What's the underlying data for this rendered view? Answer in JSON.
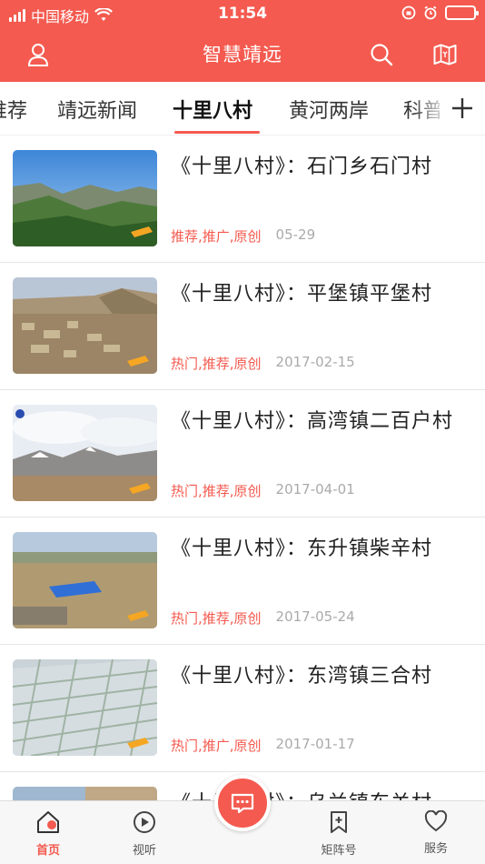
{
  "status_bar": {
    "carrier": "中国移动",
    "time": "11:54"
  },
  "header": {
    "title": "智慧靖远",
    "icons": [
      "user-icon",
      "search-icon",
      "map-icon"
    ]
  },
  "tabs": {
    "items": [
      {
        "label": "推荐"
      },
      {
        "label": "靖远新闻"
      },
      {
        "label": "十里八村"
      },
      {
        "label": "黄河两岸"
      },
      {
        "label": "科普"
      }
    ],
    "active": "十里八村",
    "add_icon": "plus-icon"
  },
  "news": [
    {
      "title": "《十里八村》：石门乡石门村",
      "tags": "推荐,推广,原创",
      "date": "05-29"
    },
    {
      "title": "《十里八村》：平堡镇平堡村",
      "tags": "热门,推荐,原创",
      "date": "2017-02-15"
    },
    {
      "title": "《十里八村》：高湾镇二百户村",
      "tags": "热门,推荐,原创",
      "date": "2017-04-01"
    },
    {
      "title": "《十里八村》：东升镇柴辛村",
      "tags": "热门,推荐,原创",
      "date": "2017-05-24"
    },
    {
      "title": "《十里八村》：东湾镇三合村",
      "tags": "热门,推广,原创",
      "date": "2017-01-17"
    },
    {
      "title": "《十里八村》：乌兰镇东关村",
      "tags": "",
      "date": ""
    }
  ],
  "bottom_nav": {
    "items": [
      {
        "label": "首页",
        "icon": "home-icon"
      },
      {
        "label": "视听",
        "icon": "play-icon"
      },
      {
        "label": "矩阵号",
        "icon": "bookmark-plus-icon"
      },
      {
        "label": "服务",
        "icon": "heart-icon"
      }
    ],
    "center_icon": "message-icon"
  },
  "colors": {
    "accent": "#f45a4f",
    "tag": "#f45a4f",
    "date": "#aaaaaa"
  }
}
